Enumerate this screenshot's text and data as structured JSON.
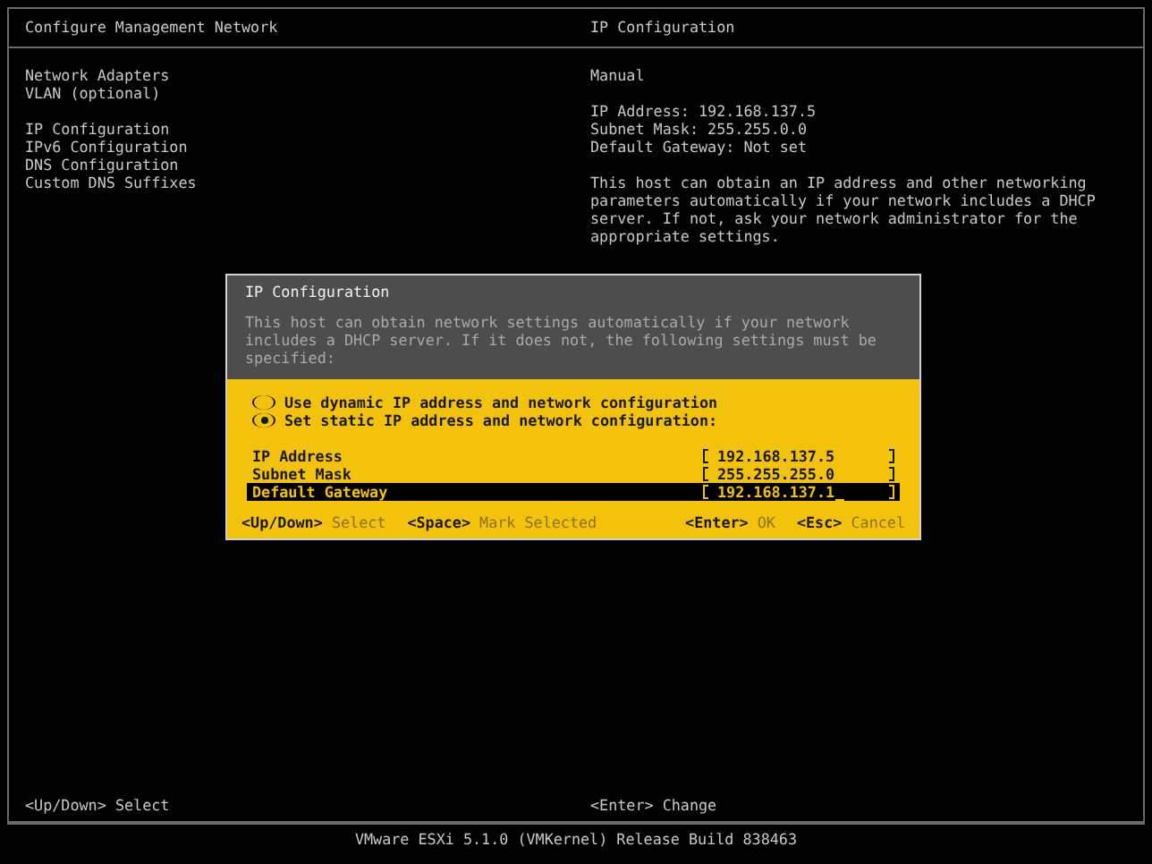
{
  "left_panel": {
    "title": "Configure Management Network",
    "menu_sections": [
      {
        "items": [
          {
            "label": "Network Adapters"
          },
          {
            "label": "VLAN (optional)"
          }
        ]
      },
      {
        "items": [
          {
            "label": "IP Configuration"
          },
          {
            "label": "IPv6 Configuration"
          },
          {
            "label": "DNS Configuration"
          },
          {
            "label": "Custom DNS Suffixes"
          }
        ]
      }
    ]
  },
  "right_panel": {
    "title": "IP Configuration",
    "mode": "Manual",
    "details": [
      "IP Address: 192.168.137.5",
      "Subnet Mask: 255.255.0.0",
      "Default Gateway: Not set"
    ],
    "description": "This host can obtain an IP address and other networking parameters automatically if your network includes a DHCP server. If not, ask your network administrator for the appropriate settings."
  },
  "dialog": {
    "title": "IP Configuration",
    "description": "This host can obtain network settings automatically if your network includes a DHCP server. If it does not, the following settings must be specified:",
    "options": [
      {
        "label": "Use dynamic IP address and network configuration",
        "selected": false
      },
      {
        "label": "Set static IP address and network configuration:",
        "selected": true
      }
    ],
    "fields": [
      {
        "label": "IP Address",
        "value": "192.168.137.5",
        "selected": false
      },
      {
        "label": "Subnet Mask",
        "value": "255.255.255.0",
        "selected": false
      },
      {
        "label": "Default Gateway",
        "value": "192.168.137.1",
        "selected": true
      }
    ],
    "hints_left": [
      {
        "key": "<Up/Down>",
        "action": "Select"
      },
      {
        "key": "<Space>",
        "action": "Mark Selected"
      }
    ],
    "hints_right": [
      {
        "key": "<Enter>",
        "action": "OK"
      },
      {
        "key": "<Esc>",
        "action": "Cancel"
      }
    ]
  },
  "bottom_bar": {
    "hints_left": [
      {
        "key": "<Up/Down>",
        "action": "Select"
      }
    ],
    "hints_right": [
      {
        "key": "<Enter>",
        "action": "Change"
      }
    ]
  },
  "footer": "VMware ESXi 5.1.0 (VMKernel) Release Build 838463"
}
